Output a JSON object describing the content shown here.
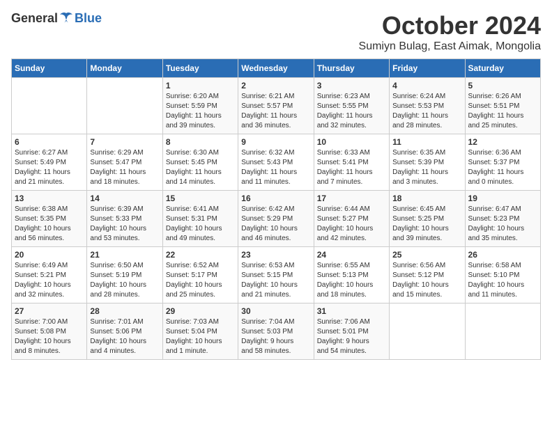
{
  "header": {
    "logo_general": "General",
    "logo_blue": "Blue",
    "month_title": "October 2024",
    "location": "Sumiyn Bulag, East Aimak, Mongolia"
  },
  "days_of_week": [
    "Sunday",
    "Monday",
    "Tuesday",
    "Wednesday",
    "Thursday",
    "Friday",
    "Saturday"
  ],
  "weeks": [
    [
      {
        "num": "",
        "info": ""
      },
      {
        "num": "",
        "info": ""
      },
      {
        "num": "1",
        "info": "Sunrise: 6:20 AM\nSunset: 5:59 PM\nDaylight: 11 hours\nand 39 minutes."
      },
      {
        "num": "2",
        "info": "Sunrise: 6:21 AM\nSunset: 5:57 PM\nDaylight: 11 hours\nand 36 minutes."
      },
      {
        "num": "3",
        "info": "Sunrise: 6:23 AM\nSunset: 5:55 PM\nDaylight: 11 hours\nand 32 minutes."
      },
      {
        "num": "4",
        "info": "Sunrise: 6:24 AM\nSunset: 5:53 PM\nDaylight: 11 hours\nand 28 minutes."
      },
      {
        "num": "5",
        "info": "Sunrise: 6:26 AM\nSunset: 5:51 PM\nDaylight: 11 hours\nand 25 minutes."
      }
    ],
    [
      {
        "num": "6",
        "info": "Sunrise: 6:27 AM\nSunset: 5:49 PM\nDaylight: 11 hours\nand 21 minutes."
      },
      {
        "num": "7",
        "info": "Sunrise: 6:29 AM\nSunset: 5:47 PM\nDaylight: 11 hours\nand 18 minutes."
      },
      {
        "num": "8",
        "info": "Sunrise: 6:30 AM\nSunset: 5:45 PM\nDaylight: 11 hours\nand 14 minutes."
      },
      {
        "num": "9",
        "info": "Sunrise: 6:32 AM\nSunset: 5:43 PM\nDaylight: 11 hours\nand 11 minutes."
      },
      {
        "num": "10",
        "info": "Sunrise: 6:33 AM\nSunset: 5:41 PM\nDaylight: 11 hours\nand 7 minutes."
      },
      {
        "num": "11",
        "info": "Sunrise: 6:35 AM\nSunset: 5:39 PM\nDaylight: 11 hours\nand 3 minutes."
      },
      {
        "num": "12",
        "info": "Sunrise: 6:36 AM\nSunset: 5:37 PM\nDaylight: 11 hours\nand 0 minutes."
      }
    ],
    [
      {
        "num": "13",
        "info": "Sunrise: 6:38 AM\nSunset: 5:35 PM\nDaylight: 10 hours\nand 56 minutes."
      },
      {
        "num": "14",
        "info": "Sunrise: 6:39 AM\nSunset: 5:33 PM\nDaylight: 10 hours\nand 53 minutes."
      },
      {
        "num": "15",
        "info": "Sunrise: 6:41 AM\nSunset: 5:31 PM\nDaylight: 10 hours\nand 49 minutes."
      },
      {
        "num": "16",
        "info": "Sunrise: 6:42 AM\nSunset: 5:29 PM\nDaylight: 10 hours\nand 46 minutes."
      },
      {
        "num": "17",
        "info": "Sunrise: 6:44 AM\nSunset: 5:27 PM\nDaylight: 10 hours\nand 42 minutes."
      },
      {
        "num": "18",
        "info": "Sunrise: 6:45 AM\nSunset: 5:25 PM\nDaylight: 10 hours\nand 39 minutes."
      },
      {
        "num": "19",
        "info": "Sunrise: 6:47 AM\nSunset: 5:23 PM\nDaylight: 10 hours\nand 35 minutes."
      }
    ],
    [
      {
        "num": "20",
        "info": "Sunrise: 6:49 AM\nSunset: 5:21 PM\nDaylight: 10 hours\nand 32 minutes."
      },
      {
        "num": "21",
        "info": "Sunrise: 6:50 AM\nSunset: 5:19 PM\nDaylight: 10 hours\nand 28 minutes."
      },
      {
        "num": "22",
        "info": "Sunrise: 6:52 AM\nSunset: 5:17 PM\nDaylight: 10 hours\nand 25 minutes."
      },
      {
        "num": "23",
        "info": "Sunrise: 6:53 AM\nSunset: 5:15 PM\nDaylight: 10 hours\nand 21 minutes."
      },
      {
        "num": "24",
        "info": "Sunrise: 6:55 AM\nSunset: 5:13 PM\nDaylight: 10 hours\nand 18 minutes."
      },
      {
        "num": "25",
        "info": "Sunrise: 6:56 AM\nSunset: 5:12 PM\nDaylight: 10 hours\nand 15 minutes."
      },
      {
        "num": "26",
        "info": "Sunrise: 6:58 AM\nSunset: 5:10 PM\nDaylight: 10 hours\nand 11 minutes."
      }
    ],
    [
      {
        "num": "27",
        "info": "Sunrise: 7:00 AM\nSunset: 5:08 PM\nDaylight: 10 hours\nand 8 minutes."
      },
      {
        "num": "28",
        "info": "Sunrise: 7:01 AM\nSunset: 5:06 PM\nDaylight: 10 hours\nand 4 minutes."
      },
      {
        "num": "29",
        "info": "Sunrise: 7:03 AM\nSunset: 5:04 PM\nDaylight: 10 hours\nand 1 minute."
      },
      {
        "num": "30",
        "info": "Sunrise: 7:04 AM\nSunset: 5:03 PM\nDaylight: 9 hours\nand 58 minutes."
      },
      {
        "num": "31",
        "info": "Sunrise: 7:06 AM\nSunset: 5:01 PM\nDaylight: 9 hours\nand 54 minutes."
      },
      {
        "num": "",
        "info": ""
      },
      {
        "num": "",
        "info": ""
      }
    ]
  ]
}
